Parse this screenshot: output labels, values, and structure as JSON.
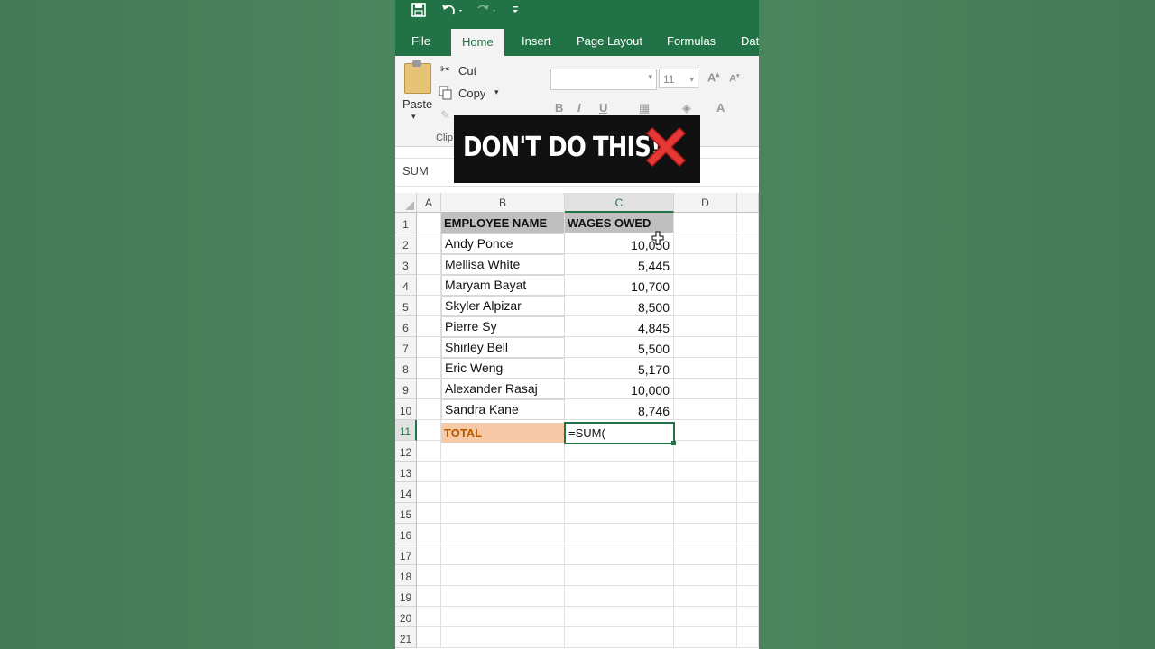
{
  "ribbon": {
    "tabs": [
      "File",
      "Home",
      "Insert",
      "Page Layout",
      "Formulas",
      "Dat"
    ],
    "active_tab": "Home",
    "paste_label": "Paste",
    "cut_label": "Cut",
    "copy_label": "Copy",
    "clipboard_group": "Clip",
    "font_size": "11",
    "bold": "B",
    "italic": "I",
    "underline": "U"
  },
  "name_box": "SUM",
  "banner": {
    "text": "DON'T DO THIS!"
  },
  "columns": [
    "A",
    "B",
    "C",
    "D"
  ],
  "selected_column": "C",
  "rows": [
    "1",
    "2",
    "3",
    "4",
    "5",
    "6",
    "7",
    "8",
    "9",
    "10",
    "11",
    "12",
    "13",
    "14",
    "15",
    "16",
    "17",
    "18",
    "19",
    "20",
    "21"
  ],
  "selected_row": "11",
  "table": {
    "headers": [
      "EMPLOYEE NAME",
      "WAGES OWED"
    ],
    "entries": [
      {
        "name": "Andy Ponce",
        "wage": "10,050"
      },
      {
        "name": "Mellisa White",
        "wage": "5,445"
      },
      {
        "name": "Maryam Bayat",
        "wage": "10,700"
      },
      {
        "name": "Skyler Alpizar",
        "wage": "8,500"
      },
      {
        "name": "Pierre Sy",
        "wage": "4,845"
      },
      {
        "name": "Shirley Bell",
        "wage": "5,500"
      },
      {
        "name": "Eric Weng",
        "wage": "5,170"
      },
      {
        "name": "Alexander Rasaj",
        "wage": "10,000"
      },
      {
        "name": "Sandra Kane",
        "wage": "8,746"
      }
    ],
    "total_label": "TOTAL",
    "formula": "=SUM("
  },
  "colors": {
    "excel_green": "#217346",
    "header_fill": "#bfbfbf",
    "total_fill": "#f8c9a6",
    "banner_x": "#e53935"
  }
}
